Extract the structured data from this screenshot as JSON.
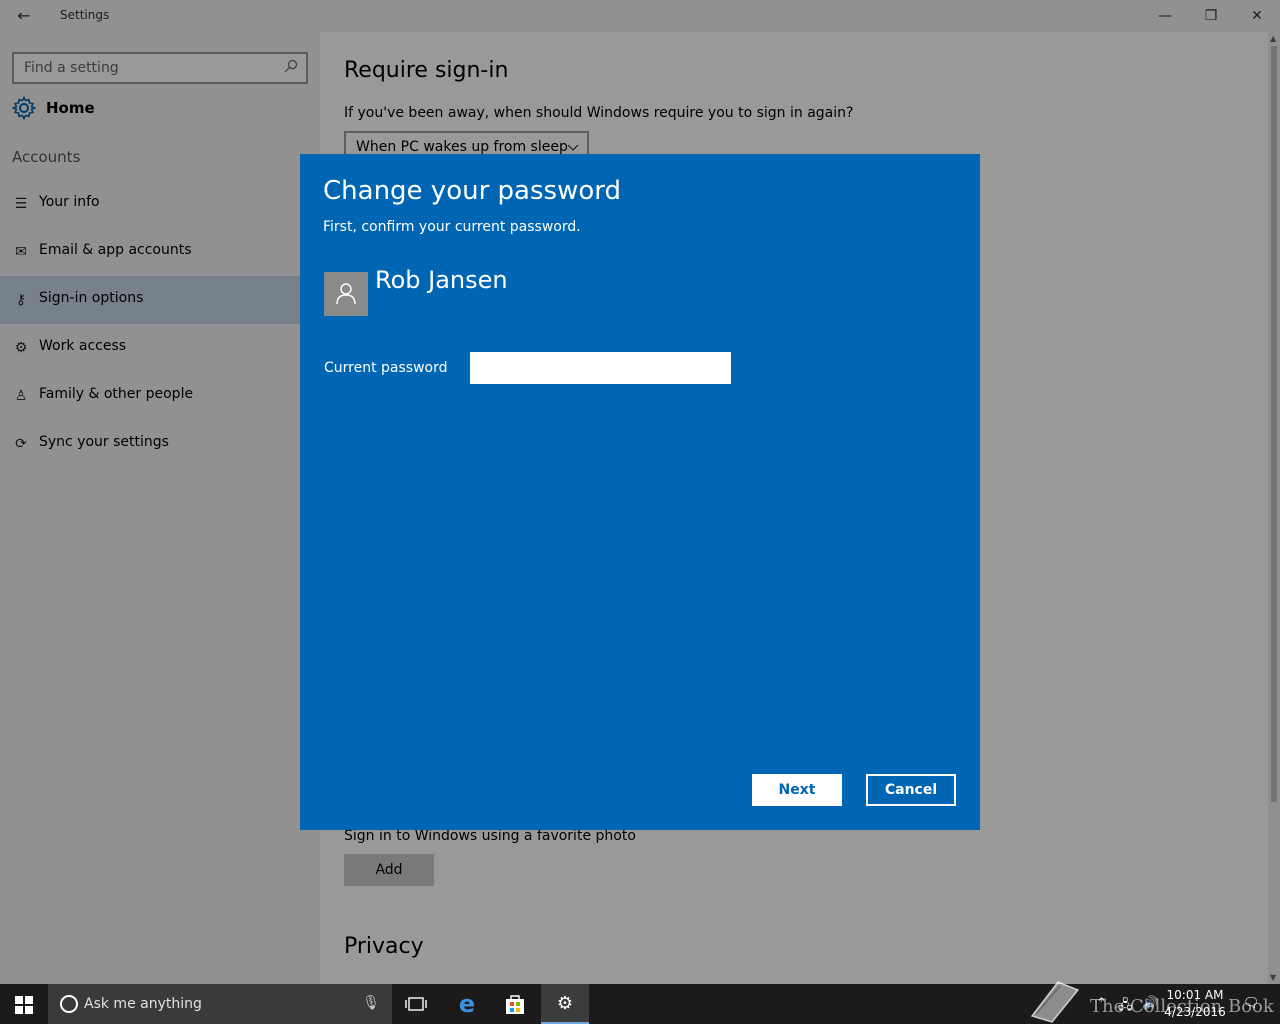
{
  "window": {
    "title": "Settings",
    "back_glyph": "←",
    "minimize_glyph": "—",
    "maximize_glyph": "❐",
    "close_glyph": "✕"
  },
  "sidebar": {
    "search_placeholder": "Find a setting",
    "home_label": "Home",
    "section_label": "Accounts",
    "items": [
      {
        "label": "Your info",
        "icon": "person-card-icon",
        "glyph": "☰"
      },
      {
        "label": "Email & app accounts",
        "icon": "mail-icon",
        "glyph": "✉"
      },
      {
        "label": "Sign-in options",
        "icon": "key-icon",
        "glyph": "⚷"
      },
      {
        "label": "Work access",
        "icon": "briefcase-gear-icon",
        "glyph": "⚙"
      },
      {
        "label": "Family & other people",
        "icon": "people-icon",
        "glyph": "♙"
      },
      {
        "label": "Sync your settings",
        "icon": "sync-icon",
        "glyph": "⟳"
      }
    ],
    "selected_index": 2
  },
  "main": {
    "heading": "Require sign-in",
    "question": "If you've been away, when should Windows require you to sign in again?",
    "dropdown_value": "When PC wakes up from sleep",
    "photo_text": "Sign in to Windows using a favorite photo",
    "add_label": "Add",
    "privacy_heading": "Privacy"
  },
  "dialog": {
    "title": "Change your password",
    "subtitle": "First, confirm your current password.",
    "user_name": "Rob Jansen",
    "password_label": "Current password",
    "password_value": "",
    "next_label": "Next",
    "cancel_label": "Cancel"
  },
  "taskbar": {
    "search_placeholder": "Ask me anything",
    "time": "10:01 AM",
    "date": "4/23/2016",
    "watermark": "The Collection Book"
  },
  "colors": {
    "dialog_bg": "#0066b4",
    "sidebar_bg": "#f2f2f2",
    "selected_bg": "#c7d7e8",
    "taskbar_bg": "#1b1b1b"
  }
}
